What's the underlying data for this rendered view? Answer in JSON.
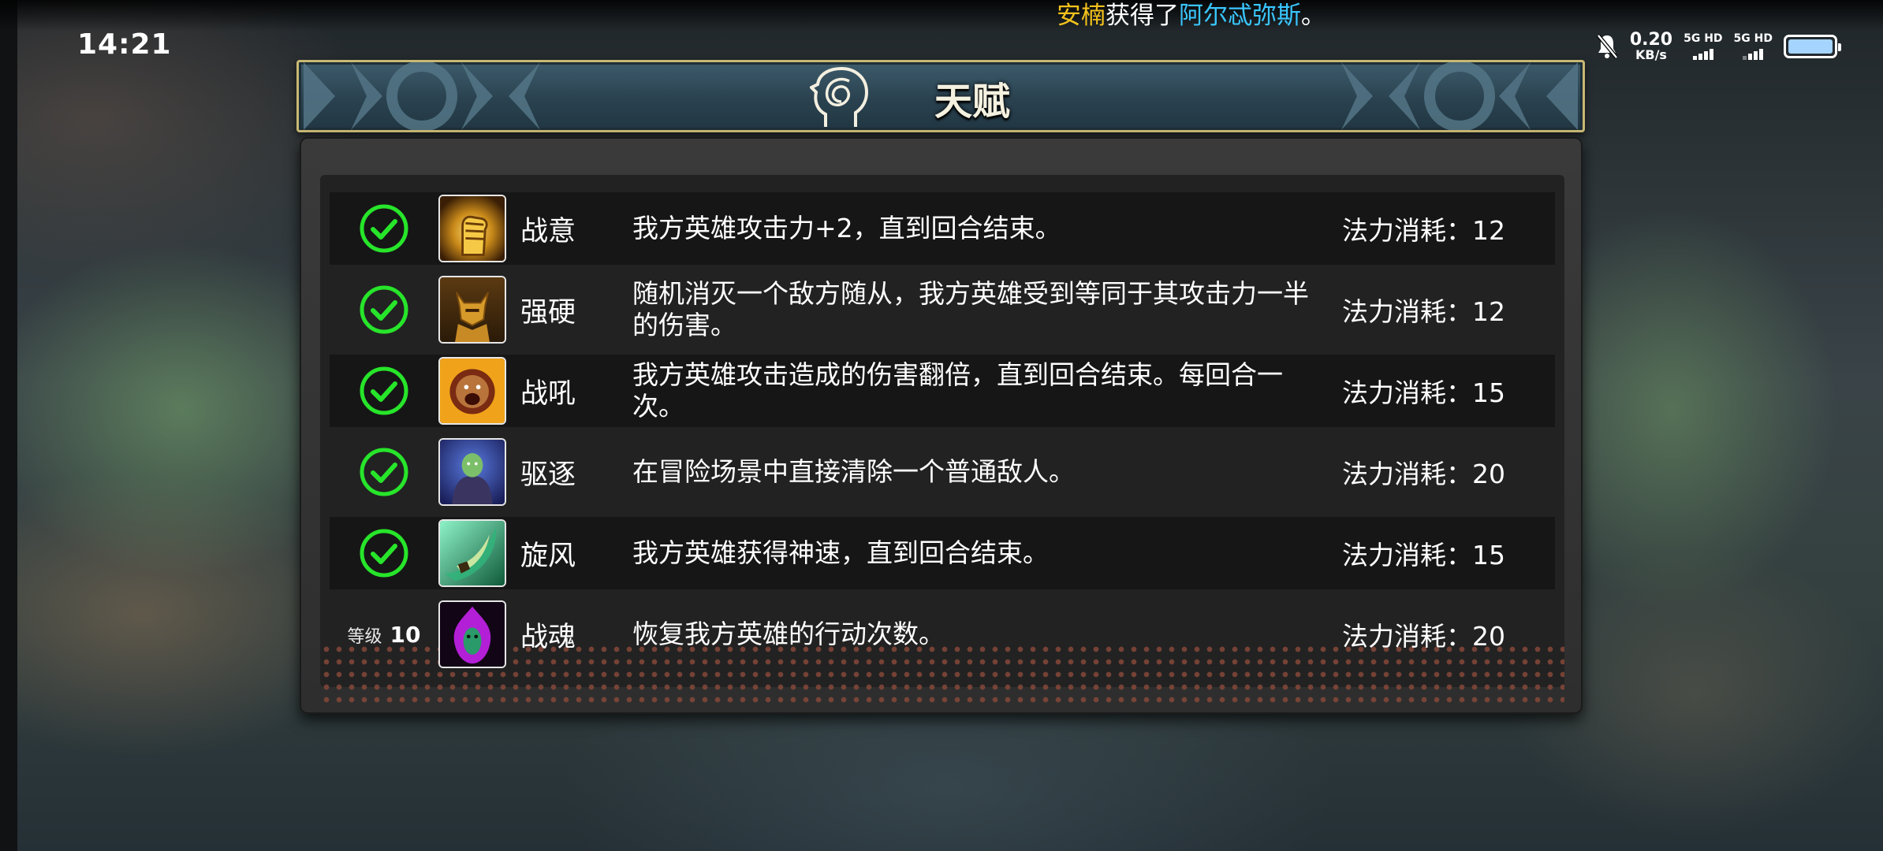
{
  "status_bar": {
    "time": "14:21",
    "speed_value": "0.20",
    "speed_unit": "KB/s",
    "sim1_label": "5G HD",
    "sim2_label": "5G HD"
  },
  "notice": {
    "player": "安楠",
    "middle": "获得了",
    "item": "阿尔忒弥斯",
    "end": "。"
  },
  "header": {
    "title": "天赋"
  },
  "talents": [
    {
      "name": "战意",
      "description": "我方英雄攻击力+2，直到回合结束。",
      "cost_label": "法力消耗：",
      "cost": "12",
      "unlocked": true
    },
    {
      "name": "强硬",
      "description": "随机消灭一个敌方随从，我方英雄受到等同于其攻击力一半的伤害。",
      "cost_label": "法力消耗：",
      "cost": "12",
      "unlocked": true
    },
    {
      "name": "战吼",
      "description": "我方英雄攻击造成的伤害翻倍，直到回合结束。每回合一次。",
      "cost_label": "法力消耗：",
      "cost": "15",
      "unlocked": true
    },
    {
      "name": "驱逐",
      "description": "在冒险场景中直接清除一个普通敌人。",
      "cost_label": "法力消耗：",
      "cost": "20",
      "unlocked": true
    },
    {
      "name": "旋风",
      "description": "我方英雄获得神速，直到回合结束。",
      "cost_label": "法力消耗：",
      "cost": "15",
      "unlocked": true
    },
    {
      "name": "战魂",
      "description": "恢复我方英雄的行动次数。",
      "cost_label": "法力消耗：",
      "cost": "20",
      "unlocked": false,
      "level_label": "等级",
      "level_value": "10"
    }
  ],
  "colors": {
    "check_green": "#27e52a",
    "notice_player": "#f3c21c",
    "notice_item": "#3ac6ff",
    "banner_border": "#c8b873"
  },
  "icons": {
    "check": "check-circle-icon",
    "talent_icons": [
      "golden-fist-icon",
      "horned-warrior-icon",
      "roaring-beast-icon",
      "hooded-figure-icon",
      "green-blade-icon",
      "purple-flame-mask-icon"
    ]
  }
}
